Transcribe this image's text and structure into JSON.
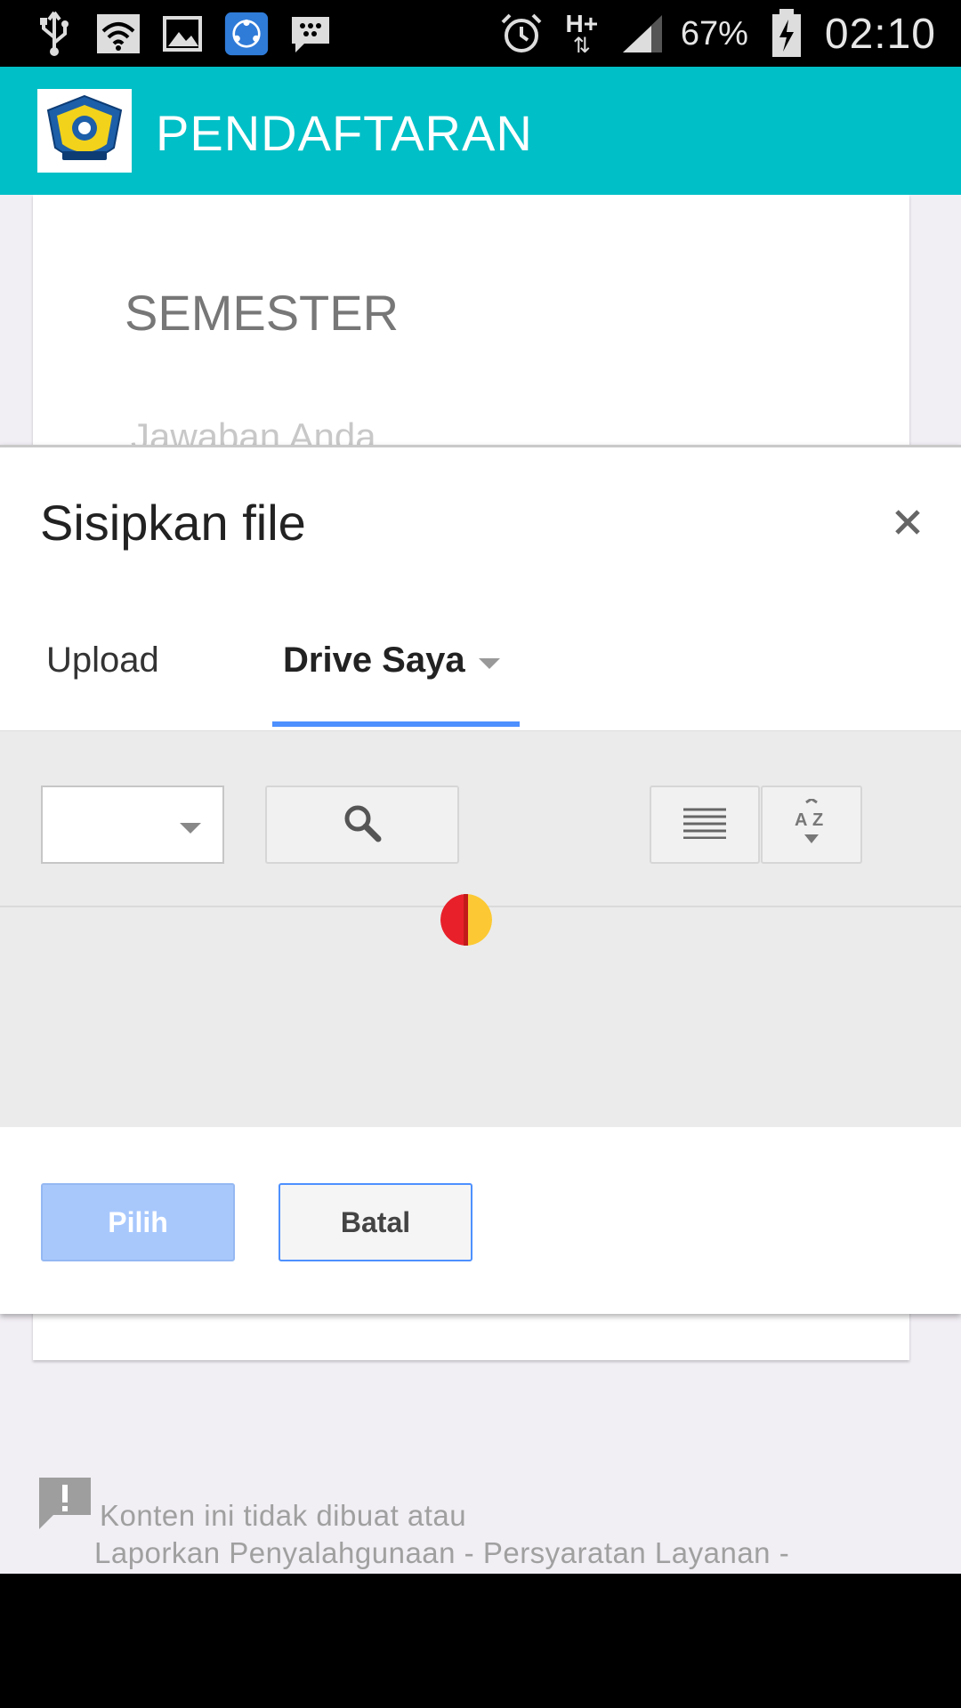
{
  "status_bar": {
    "battery": "67%",
    "time": "02:10",
    "network": "H+",
    "left_icons": [
      "usb-icon",
      "wifi-icon",
      "image-icon",
      "shareit-icon",
      "bbm-icon"
    ],
    "right_icons": [
      "alarm-icon",
      "network-arrows-icon",
      "signal-icon",
      "battery-charging-icon"
    ]
  },
  "app_bar": {
    "title": "PENDAFTARAN",
    "color": "#00bfc6"
  },
  "form": {
    "question_title": "SEMESTER",
    "answer_placeholder": "Jawaban Anda"
  },
  "dialog": {
    "title": "Sisipkan file",
    "close_icon": "close-icon",
    "tabs": [
      {
        "label": "Upload",
        "active": false
      },
      {
        "label": "Drive Saya",
        "active": true
      }
    ],
    "accent": "#4d90fe",
    "buttons": {
      "select_label": "Pilih",
      "cancel_label": "Batal"
    }
  },
  "footer": {
    "line1": "Konten ini tidak dibuat atau",
    "line2": "Laporkan Penyalahgunaan - Persyaratan Layanan -"
  }
}
